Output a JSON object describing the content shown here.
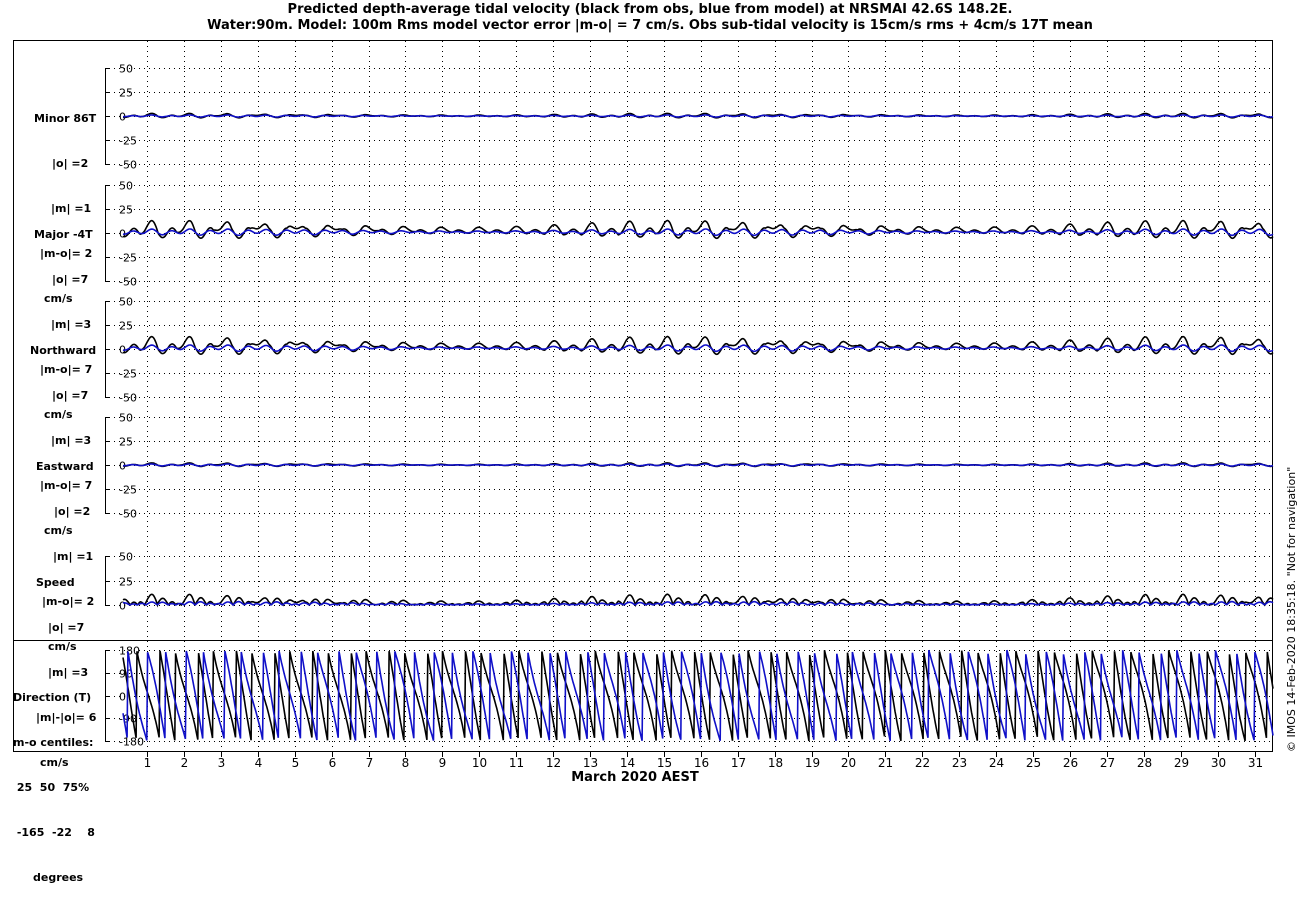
{
  "title": {
    "line1": "Predicted depth-average tidal velocity (black from obs, blue from model) at NRSMAI 42.6S 148.2E.",
    "line2": "Water:90m. Model: 100m  Rms model vector error |m-o| = 7 cm/s. Obs sub-tidal velocity is 15cm/s rms + 4cm/s 17T mean"
  },
  "credit": "© IMOS 14-Feb-2020 18:35:18.  \"Not for navigation\"",
  "xlabel": "March 2020 AEST",
  "colors": {
    "obs": "#000000",
    "model": "#1010c8",
    "axis": "#000000",
    "grid": "#000000"
  },
  "chart_data": {
    "type": "line",
    "xlabel": "March 2020 AEST",
    "x_ticks": [
      "1",
      "2",
      "3",
      "4",
      "5",
      "6",
      "7",
      "8",
      "9",
      "10",
      "11",
      "12",
      "13",
      "14",
      "15",
      "16",
      "17",
      "18",
      "19",
      "20",
      "21",
      "22",
      "23",
      "24",
      "25",
      "26",
      "27",
      "28",
      "29",
      "30",
      "31"
    ],
    "xlim": [
      0.35,
      31.5
    ],
    "grid": true,
    "series_legend": {
      "obs": "black from obs",
      "model": "blue from model"
    },
    "panels": [
      {
        "id": "minor",
        "label": [
          "Minor 86T",
          "|o| =2",
          "|m| =1",
          "|m-o|= 2",
          "cm/s"
        ],
        "ylim": [
          -50,
          50
        ],
        "yticks": [
          "-50",
          "-25",
          "0",
          "25",
          "50"
        ],
        "obs_amp": 2.5,
        "model_amp": 1.0,
        "obs_offset": 0,
        "model_offset": 0,
        "phase_shift": 0.4
      },
      {
        "id": "major",
        "label": [
          "Major -4T",
          "|o| =7",
          "|m| =3",
          "|m-o|= 7",
          "cm/s"
        ],
        "ylim": [
          -50,
          50
        ],
        "yticks": [
          "-50",
          "-25",
          "0",
          "25",
          "50"
        ],
        "obs_amp": 10,
        "model_amp": 3,
        "obs_offset": 2,
        "model_offset": 1,
        "phase_shift": 0.3
      },
      {
        "id": "north",
        "label": [
          "Northward",
          "|o| =7",
          "|m| =3",
          "|m-o|= 7",
          "cm/s"
        ],
        "ylim": [
          -50,
          50
        ],
        "yticks": [
          "-50",
          "-25",
          "0",
          "25",
          "50"
        ],
        "obs_amp": 10,
        "model_amp": 3,
        "obs_offset": 2,
        "model_offset": 1,
        "phase_shift": 0.3
      },
      {
        "id": "east",
        "label": [
          "Eastward",
          "|o| =2",
          "|m| =1",
          "|m-o|= 2",
          "cm/s"
        ],
        "ylim": [
          -50,
          50
        ],
        "yticks": [
          "-50",
          "-25",
          "0",
          "25",
          "50"
        ],
        "obs_amp": 2,
        "model_amp": 1,
        "obs_offset": 0,
        "model_offset": 0,
        "phase_shift": 0.5
      },
      {
        "id": "speed",
        "label": [
          "Speed",
          "|o| =7",
          "|m| =3",
          "|m|-|o|= 6",
          "cm/s"
        ],
        "ylim": [
          0,
          50
        ],
        "yticks": [
          "0",
          "25",
          "50"
        ],
        "obs_amp": 10,
        "model_amp": 3,
        "obs_offset": 0,
        "model_offset": 0,
        "phase_shift": 0.3
      },
      {
        "id": "direction",
        "label": [
          "Direction (T)",
          "m-o centiles:",
          " 25  50  75%",
          " -165  -22    8",
          "degrees"
        ],
        "ylim": [
          -180,
          180
        ],
        "yticks": [
          "-180",
          "-90",
          "0",
          "90",
          "180"
        ]
      }
    ]
  }
}
